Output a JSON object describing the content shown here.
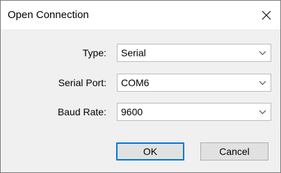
{
  "window": {
    "title": "Open Connection",
    "close_icon": "close-icon"
  },
  "form": {
    "type": {
      "label": "Type:",
      "value": "Serial"
    },
    "serial_port": {
      "label": "Serial Port:",
      "value": "COM6"
    },
    "baud_rate": {
      "label": "Baud Rate:",
      "value": "9600"
    }
  },
  "buttons": {
    "ok_label": "OK",
    "cancel_label": "Cancel"
  },
  "colors": {
    "focus_accent": "#0078d7",
    "client_background": "#f0f0f0"
  }
}
